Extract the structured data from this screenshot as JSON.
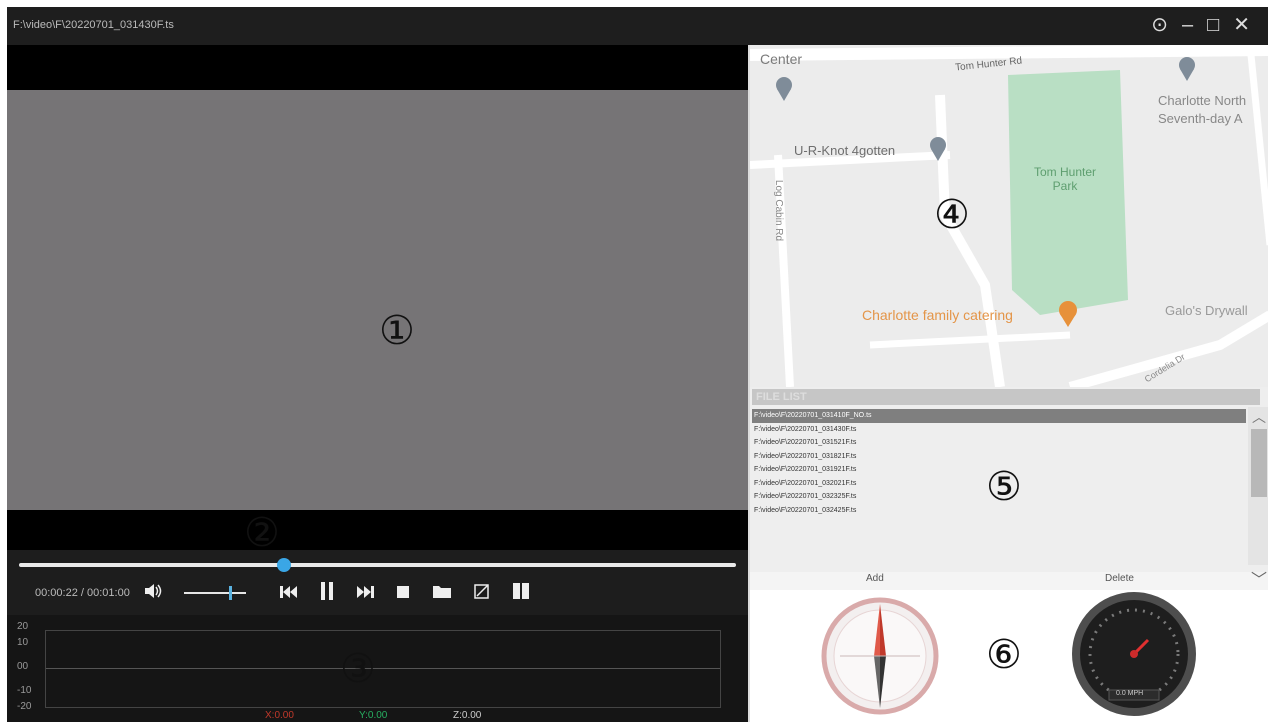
{
  "window": {
    "title": "F:\\video\\F\\20220701_031430F.ts",
    "controls": [
      "⊙",
      "–",
      "□",
      "✕"
    ]
  },
  "callouts": {
    "video": "①",
    "progress": "②",
    "graph": "③",
    "map": "④",
    "filelist": "⑤",
    "gauges": "⑥"
  },
  "player": {
    "progress_fraction": 0.37,
    "time": "00:00:22 / 00:01:00",
    "volume_fraction": 0.75,
    "icons": [
      "volume-icon",
      "previous-icon",
      "pause-icon",
      "next-icon",
      "stop-icon",
      "folder-icon",
      "snapshot-icon",
      "split-icon"
    ]
  },
  "graph": {
    "y_labels": [
      "20",
      "10",
      "00",
      "-10",
      "-20"
    ],
    "legend": [
      {
        "text": "X:0.00",
        "color": "#c0392b"
      },
      {
        "text": "Y:0.00",
        "color": "#27ae60"
      },
      {
        "text": "Z:0.00",
        "color": "#cccccc"
      }
    ]
  },
  "map": {
    "labels": {
      "center": "Center",
      "road1": "Tom Hunter Rd",
      "place1": "U-R-Knot 4gotten",
      "road2": "Log Cabin Rd",
      "park": "Tom Hunter Park",
      "church1": "Charlotte North",
      "church2": "Seventh-day A",
      "catering": "Charlotte family catering",
      "drywall": "Galo's Drywall",
      "road3": "Cordelia Dr"
    }
  },
  "filelist": {
    "header": "FILE LIST",
    "items": [
      "F:\\video\\F\\20220701_031410F_NO.ts",
      "F:\\video\\F\\20220701_031430F.ts",
      "F:\\video\\F\\20220701_031521F.ts",
      "F:\\video\\F\\20220701_031821F.ts",
      "F:\\video\\F\\20220701_031921F.ts",
      "F:\\video\\F\\20220701_032021F.ts",
      "F:\\video\\F\\20220701_032325F.ts",
      "F:\\video\\F\\20220701_032425F.ts"
    ],
    "selected_index": 0,
    "add_label": "Add",
    "delete_label": "Delete"
  },
  "speedometer": {
    "reading": "0.0 MPH"
  }
}
